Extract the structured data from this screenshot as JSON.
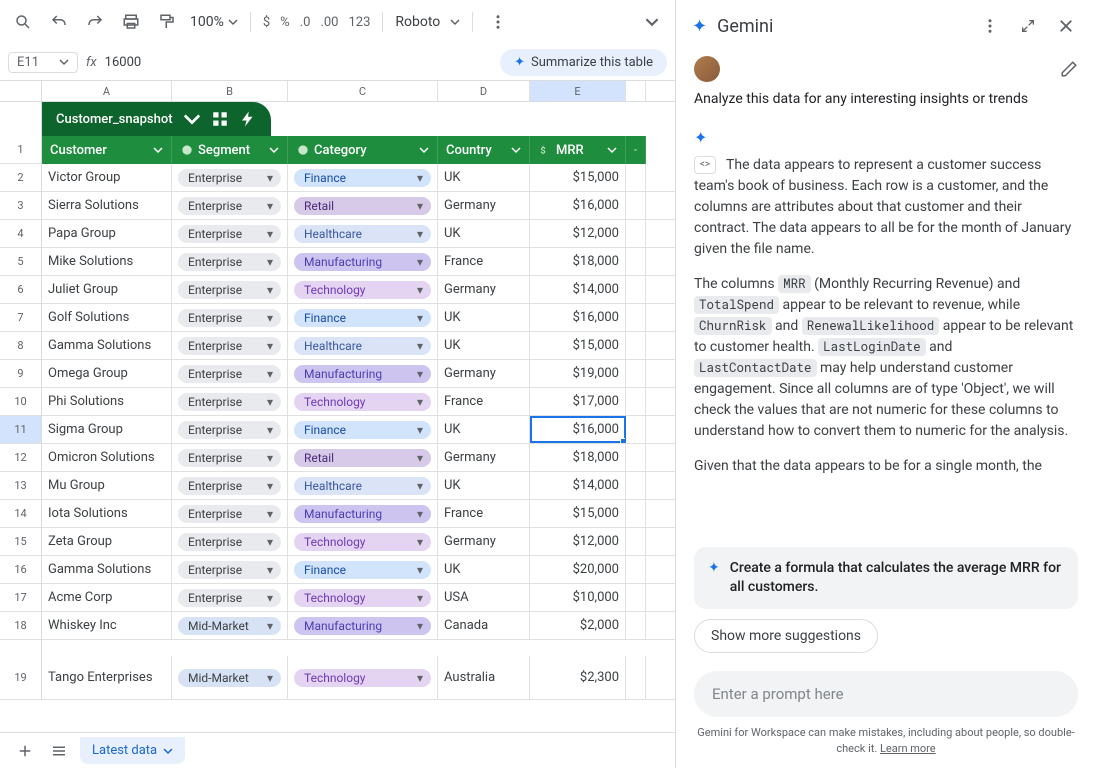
{
  "toolbar": {
    "zoom": "100%",
    "currency": "$",
    "percent": "%",
    "dec_dec": ".0",
    "inc_dec": ".00",
    "num_123": "123",
    "font": "Roboto"
  },
  "formula_bar": {
    "cell_ref": "E11",
    "value": "16000",
    "summarize_label": "Summarize this table"
  },
  "columns": [
    "A",
    "B",
    "C",
    "D",
    "E"
  ],
  "table_name": "Customer_snapshot",
  "headers": {
    "customer": "Customer",
    "segment": "Segment",
    "category": "Category",
    "country": "Country",
    "mrr": "MRR"
  },
  "rows": [
    {
      "n": "2",
      "customer": "Victor Group",
      "segment": "Enterprise",
      "category": "Finance",
      "country": "UK",
      "mrr": "$15,000"
    },
    {
      "n": "3",
      "customer": "Sierra Solutions",
      "segment": "Enterprise",
      "category": "Retail",
      "country": "Germany",
      "mrr": "$16,000"
    },
    {
      "n": "4",
      "customer": "Papa Group",
      "segment": "Enterprise",
      "category": "Healthcare",
      "country": "UK",
      "mrr": "$12,000"
    },
    {
      "n": "5",
      "customer": "Mike Solutions",
      "segment": "Enterprise",
      "category": "Manufacturing",
      "country": "France",
      "mrr": "$18,000"
    },
    {
      "n": "6",
      "customer": "Juliet Group",
      "segment": "Enterprise",
      "category": "Technology",
      "country": "Germany",
      "mrr": "$14,000"
    },
    {
      "n": "7",
      "customer": "Golf Solutions",
      "segment": "Enterprise",
      "category": "Finance",
      "country": "UK",
      "mrr": "$16,000"
    },
    {
      "n": "8",
      "customer": "Gamma Solutions",
      "segment": "Enterprise",
      "category": "Healthcare",
      "country": "UK",
      "mrr": "$15,000"
    },
    {
      "n": "9",
      "customer": "Omega Group",
      "segment": "Enterprise",
      "category": "Manufacturing",
      "country": "Germany",
      "mrr": "$19,000"
    },
    {
      "n": "10",
      "customer": "Phi Solutions",
      "segment": "Enterprise",
      "category": "Technology",
      "country": "France",
      "mrr": "$17,000"
    },
    {
      "n": "11",
      "customer": "Sigma Group",
      "segment": "Enterprise",
      "category": "Finance",
      "country": "UK",
      "mrr": "$16,000"
    },
    {
      "n": "12",
      "customer": "Omicron Solutions",
      "segment": "Enterprise",
      "category": "Retail",
      "country": "Germany",
      "mrr": "$18,000"
    },
    {
      "n": "13",
      "customer": "Mu Group",
      "segment": "Enterprise",
      "category": "Healthcare",
      "country": "UK",
      "mrr": "$14,000"
    },
    {
      "n": "14",
      "customer": "Iota Solutions",
      "segment": "Enterprise",
      "category": "Manufacturing",
      "country": "France",
      "mrr": "$15,000"
    },
    {
      "n": "15",
      "customer": "Zeta Group",
      "segment": "Enterprise",
      "category": "Technology",
      "country": "Germany",
      "mrr": "$12,000"
    },
    {
      "n": "16",
      "customer": "Gamma Solutions",
      "segment": "Enterprise",
      "category": "Finance",
      "country": "UK",
      "mrr": "$20,000"
    },
    {
      "n": "17",
      "customer": "Acme Corp",
      "segment": "Enterprise",
      "category": "Technology",
      "country": "USA",
      "mrr": "$10,000"
    },
    {
      "n": "18",
      "customer": "Whiskey Inc",
      "segment": "Mid-Market",
      "category": "Manufacturing",
      "country": "Canada",
      "mrr": "$2,000"
    },
    {
      "n": "19",
      "customer": "Tango Enterprises",
      "segment": "Mid-Market",
      "category": "Technology",
      "country": "Australia",
      "mrr": "$2,300"
    }
  ],
  "selected_row": "11",
  "tabs": {
    "active": "Latest data"
  },
  "gemini": {
    "title": "Gemini",
    "user_prompt": "Analyze this data for any interesting insights or trends",
    "response": {
      "p1a": "The data appears to represent a customer success team's book of business. Each row is a customer, and the columns are attributes about that customer and their contract. The data appears to all be for the month of January given the file name.",
      "p2_pre": "The columns ",
      "code1": "MRR",
      "p2_mid1": " (Monthly Recurring Revenue) and ",
      "code2": "TotalSpend",
      "p2_mid2": " appear to be relevant to revenue, while ",
      "code3": "ChurnRisk",
      "p2_mid3": " and ",
      "code4": "RenewalLikelihood",
      "p2_mid4": " appear to be relevant to customer health. ",
      "code5": "LastLoginDate",
      "p2_mid5": " and ",
      "code6": "LastContactDate",
      "p2_mid6": " may help understand customer engagement. Since all columns are of type 'Object', we will check the values that are not numeric for these columns to understand how to convert them to numeric for the analysis.",
      "p3": "Given that the data appears to be for a single month, the"
    },
    "suggestion": "Create a formula that calculates the average MRR for all customers.",
    "show_more": "Show more suggestions",
    "placeholder": "Enter a prompt here",
    "disclaimer_a": "Gemini for Workspace can make mistakes, including about people, so double-check it. ",
    "disclaimer_link": "Learn more"
  },
  "category_class": {
    "Finance": "chip-finance",
    "Retail": "chip-retail",
    "Healthcare": "chip-healthcare",
    "Manufacturing": "chip-manufacturing",
    "Technology": "chip-technology"
  },
  "segment_class": {
    "Enterprise": "chip-enterprise",
    "Mid-Market": "chip-midmarket"
  }
}
